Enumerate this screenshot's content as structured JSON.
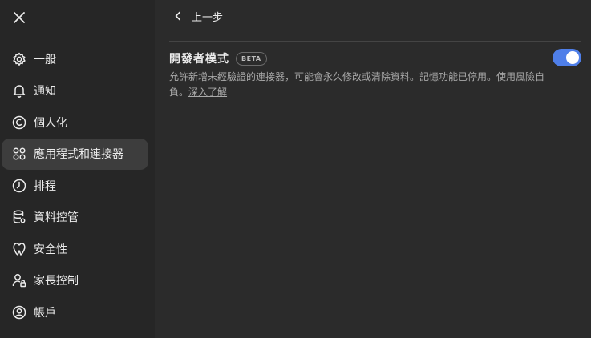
{
  "sidebar": {
    "items": [
      {
        "label": "一般",
        "icon": "gear-icon"
      },
      {
        "label": "通知",
        "icon": "bell-icon"
      },
      {
        "label": "個人化",
        "icon": "personalization-icon"
      },
      {
        "label": "應用程式和連接器",
        "icon": "apps-grid-icon",
        "active": true
      },
      {
        "label": "排程",
        "icon": "clock-icon"
      },
      {
        "label": "資料控管",
        "icon": "database-icon"
      },
      {
        "label": "安全性",
        "icon": "shield-icon"
      },
      {
        "label": "家長控制",
        "icon": "parent-lock-icon"
      },
      {
        "label": "帳戶",
        "icon": "account-icon"
      }
    ]
  },
  "main": {
    "back_label": "上一步",
    "setting": {
      "title": "開發者模式",
      "badge": "BETA",
      "description": "允許新增未經驗證的連接器，可能會永久修改或清除資料。記憶功能已停用。使用風險自負。",
      "learn_more": "深入了解",
      "enabled": true
    }
  },
  "colors": {
    "accent": "#4f7fe9",
    "sidebar_bg": "#262626",
    "main_bg": "#2b2b2b",
    "active_item_bg": "#3d3d3d"
  }
}
